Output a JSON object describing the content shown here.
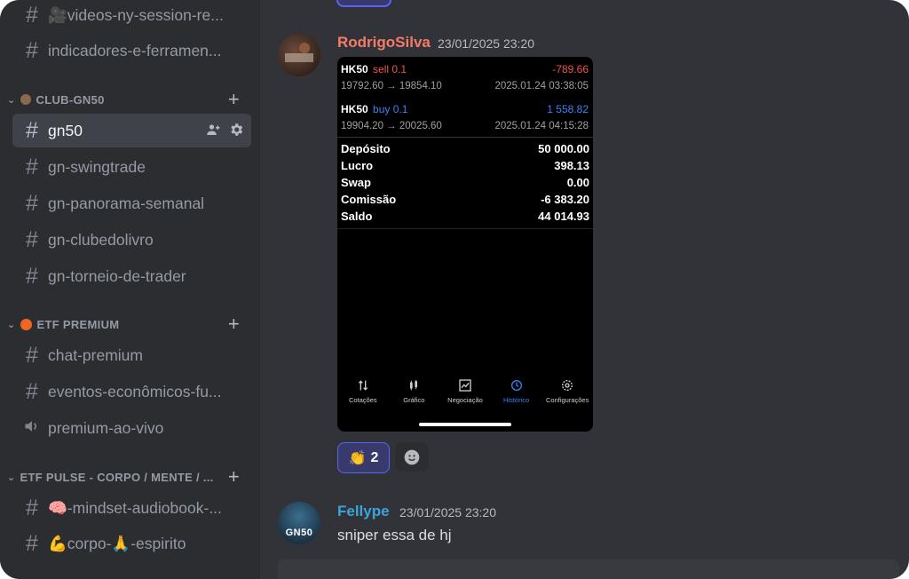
{
  "sidebar": {
    "channels_top": [
      {
        "name": "🎥videos-ny-session-re...",
        "icon": "hash-icon"
      },
      {
        "name": "indicadores-e-ferramen...",
        "icon": "hash-icon"
      }
    ],
    "category_club": {
      "label": "CLUB-GN50"
    },
    "club_channels": [
      {
        "name": "gn50",
        "active": true
      },
      {
        "name": "gn-swingtrade"
      },
      {
        "name": "gn-panorama-semanal"
      },
      {
        "name": "gn-clubedolivro"
      },
      {
        "name": "gn-torneio-de-trader"
      }
    ],
    "category_premium": {
      "label": "ETF PREMIUM",
      "dot_color": "#f26522"
    },
    "premium_channels": [
      {
        "name": "chat-premium",
        "icon": "hash-thread-icon"
      },
      {
        "name": "eventos-econômicos-fu...",
        "icon": "hash-thread-icon"
      },
      {
        "name": "premium-ao-vivo",
        "icon": "speaker-icon"
      }
    ],
    "category_pulse": {
      "label": "ETF PULSE - CORPO / MENTE / ..."
    },
    "pulse_channels": [
      {
        "name": "🧠-mindset-audiobook-..."
      },
      {
        "name": "💪corpo-🙏-espirito"
      }
    ]
  },
  "messages": [
    {
      "author": "RodrigoSilva",
      "author_color": "#f47b67",
      "timestamp": "23/01/2025 23:20",
      "trade_screen": {
        "trades": [
          {
            "symbol": "HK50",
            "side": "sell 0.1",
            "pnl": "-789.66",
            "prices": "19792.60 → 19854.10",
            "time": "2025.01.24 03:38:05",
            "side_color": "#ef5350"
          },
          {
            "symbol": "HK50",
            "side": "buy 0.1",
            "pnl": "1 558.82",
            "prices": "19904.20 → 20025.60",
            "time": "2025.01.24 04:15:28",
            "side_color": "#3b82f6"
          }
        ],
        "summary": [
          {
            "label": "Depósito",
            "value": "50 000.00"
          },
          {
            "label": "Lucro",
            "value": "398.13"
          },
          {
            "label": "Swap",
            "value": "0.00"
          },
          {
            "label": "Comissão",
            "value": "-6 383.20"
          },
          {
            "label": "Saldo",
            "value": "44 014.93"
          }
        ],
        "tabs": [
          {
            "label": "Cotações",
            "icon": "arrows-updown-icon"
          },
          {
            "label": "Gráfico",
            "icon": "candles-icon"
          },
          {
            "label": "Negociação",
            "icon": "chart-line-icon"
          },
          {
            "label": "Histórico",
            "icon": "history-icon",
            "active": true
          },
          {
            "label": "Configurações",
            "icon": "gear-icon"
          }
        ]
      },
      "reactions": [
        {
          "emoji": "👏",
          "count": "2"
        }
      ]
    },
    {
      "author": "Fellype",
      "author_color": "#3ba4d8",
      "timestamp": "23/01/2025 23:20",
      "text": "sniper essa de hj",
      "avatar_text": "GN50"
    }
  ]
}
